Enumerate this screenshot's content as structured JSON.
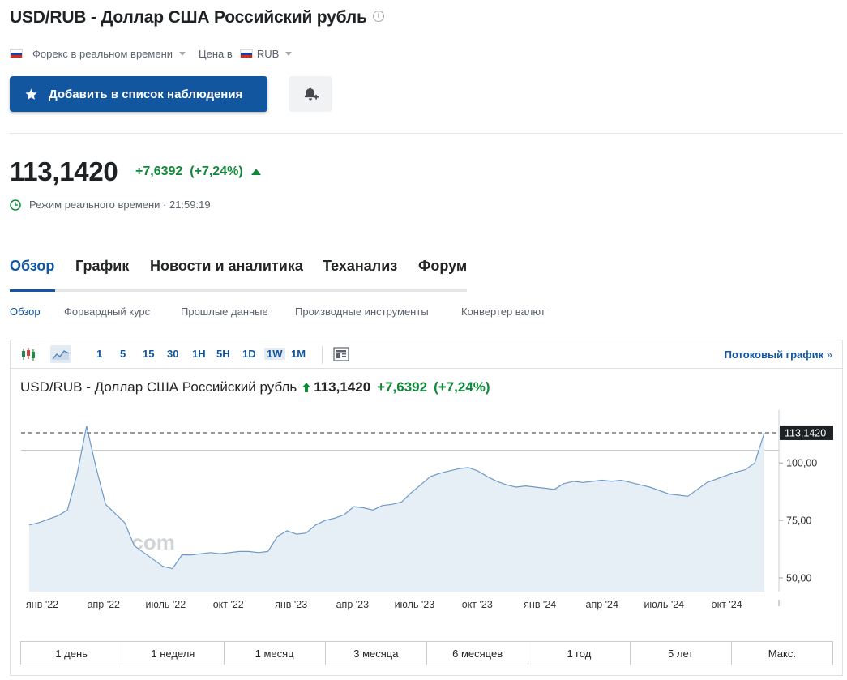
{
  "header": {
    "title": "USD/RUB - Доллар США Российский рубль",
    "market": "Форекс в реальном времени",
    "currency_prefix": "Цена в",
    "currency": "RUB"
  },
  "actions": {
    "watchlist": "Добавить в список наблюдения"
  },
  "quote": {
    "price": "113,1420",
    "change": "+7,6392",
    "change_pct": "(+7,24%)",
    "realtime": "Режим реального времени · 21:59:19",
    "up_color": "#0f8a3a"
  },
  "tabs": [
    "Обзор",
    "График",
    "Новости и аналитика",
    "Теханализ",
    "Форум"
  ],
  "subtabs": [
    "Обзор",
    "Форвардный курс",
    "Прошлые данные",
    "Производные инструменты",
    "Конвертер валют"
  ],
  "chart_toolbar": {
    "intervals": [
      "1",
      "5",
      "15",
      "30",
      "1H",
      "5H",
      "1D",
      "1W",
      "1M"
    ],
    "selected": "1W",
    "stream_link": "Потоковый график"
  },
  "chart_header": {
    "name": "USD/RUB - Доллар США Российский рубль",
    "price": "113,1420",
    "change": "+7,6392",
    "change_pct": "(+7,24%)"
  },
  "ranges": [
    "1 день",
    "1 неделя",
    "1 месяц",
    "3 месяца",
    "6 месяцев",
    "1 год",
    "5 лет",
    "Макс."
  ],
  "chart_data": {
    "type": "area",
    "watermark": "Investing.com",
    "ylim": [
      44,
      123
    ],
    "yticks": [
      "100,00",
      "75,00",
      "50,00"
    ],
    "ytick_values": [
      100,
      75,
      50
    ],
    "x_ticks": [
      "янв '22",
      "апр '22",
      "июль '22",
      "окт '22",
      "янв '23",
      "апр '23",
      "июль '23",
      "окт '23",
      "янв '24",
      "апр '24",
      "июль '24",
      "окт '24"
    ],
    "last_label": "113,1420",
    "last_value": 113.142,
    "ref_line": 105.5,
    "line_color": "#6e9ac8",
    "fill_color": "#e6eef6",
    "x": [
      "2021-12-13",
      "2021-12-27",
      "2022-01-10",
      "2022-01-24",
      "2022-02-07",
      "2022-02-21",
      "2022-03-07",
      "2022-03-21",
      "2022-04-04",
      "2022-04-18",
      "2022-05-02",
      "2022-05-16",
      "2022-05-30",
      "2022-06-13",
      "2022-06-27",
      "2022-07-11",
      "2022-07-25",
      "2022-08-08",
      "2022-08-22",
      "2022-09-05",
      "2022-09-19",
      "2022-10-03",
      "2022-10-17",
      "2022-10-31",
      "2022-11-14",
      "2022-11-28",
      "2022-12-12",
      "2022-12-26",
      "2023-01-09",
      "2023-01-23",
      "2023-02-06",
      "2023-02-20",
      "2023-03-06",
      "2023-03-20",
      "2023-04-03",
      "2023-04-17",
      "2023-05-01",
      "2023-05-15",
      "2023-05-29",
      "2023-06-12",
      "2023-06-26",
      "2023-07-10",
      "2023-07-24",
      "2023-08-07",
      "2023-08-21",
      "2023-09-04",
      "2023-09-18",
      "2023-10-02",
      "2023-10-16",
      "2023-10-30",
      "2023-11-13",
      "2023-11-27",
      "2023-12-11",
      "2023-12-25",
      "2024-01-08",
      "2024-01-22",
      "2024-02-05",
      "2024-02-19",
      "2024-03-04",
      "2024-03-18",
      "2024-04-01",
      "2024-04-15",
      "2024-04-29",
      "2024-05-13",
      "2024-05-27",
      "2024-06-10",
      "2024-06-24",
      "2024-07-08",
      "2024-07-22",
      "2024-08-05",
      "2024-08-19",
      "2024-09-02",
      "2024-09-16",
      "2024-09-30",
      "2024-10-14",
      "2024-10-28",
      "2024-11-11",
      "2024-11-25"
    ],
    "values": [
      73,
      74,
      75.5,
      77,
      79.5,
      95,
      116,
      98,
      82,
      78,
      74,
      64,
      61,
      58,
      55,
      54,
      60,
      60,
      60.5,
      61,
      60.5,
      61,
      61.5,
      61.5,
      61,
      61.5,
      68,
      70.5,
      69,
      69.5,
      73,
      75,
      76,
      77.5,
      81,
      80.5,
      79.5,
      81.5,
      82,
      83,
      87,
      90.5,
      94,
      95.5,
      96.5,
      97.5,
      98,
      96.5,
      94,
      92,
      90.5,
      89.5,
      90,
      89.5,
      89,
      88.5,
      91,
      92,
      91.5,
      92,
      92.5,
      92,
      92.5,
      91.5,
      90.5,
      89.5,
      88,
      86.5,
      86,
      85.5,
      88.5,
      91.5,
      93,
      94.5,
      96,
      97,
      100,
      113.1
    ]
  }
}
